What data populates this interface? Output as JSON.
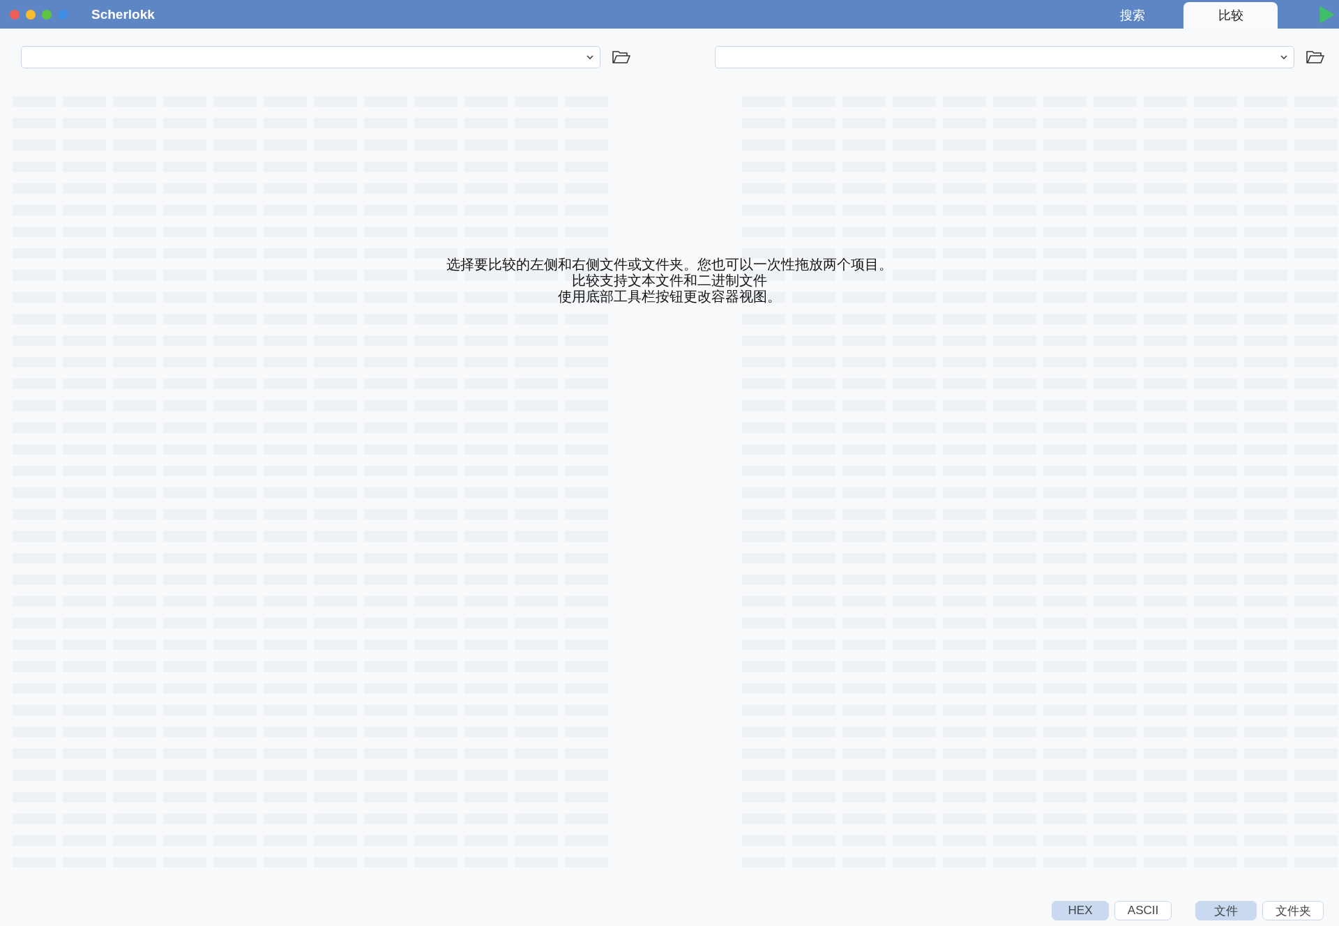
{
  "window": {
    "title": "Scherlokk"
  },
  "tabs": [
    {
      "label": "搜索",
      "selected": false
    },
    {
      "label": "比较",
      "selected": true
    }
  ],
  "message": [
    "选择要比较的左侧和右侧文件或文件夹。您也可以一次性拖放两个项目。",
    "比较支持文本文件和二进制文件",
    "使用底部工具栏按钮更改容器视图。"
  ],
  "view_modes": [
    {
      "label": "HEX",
      "selected": true
    },
    {
      "label": "ASCII",
      "selected": false
    }
  ],
  "containers": [
    {
      "label": "文件",
      "selected": true
    },
    {
      "label": "文件夹",
      "selected": false
    }
  ]
}
